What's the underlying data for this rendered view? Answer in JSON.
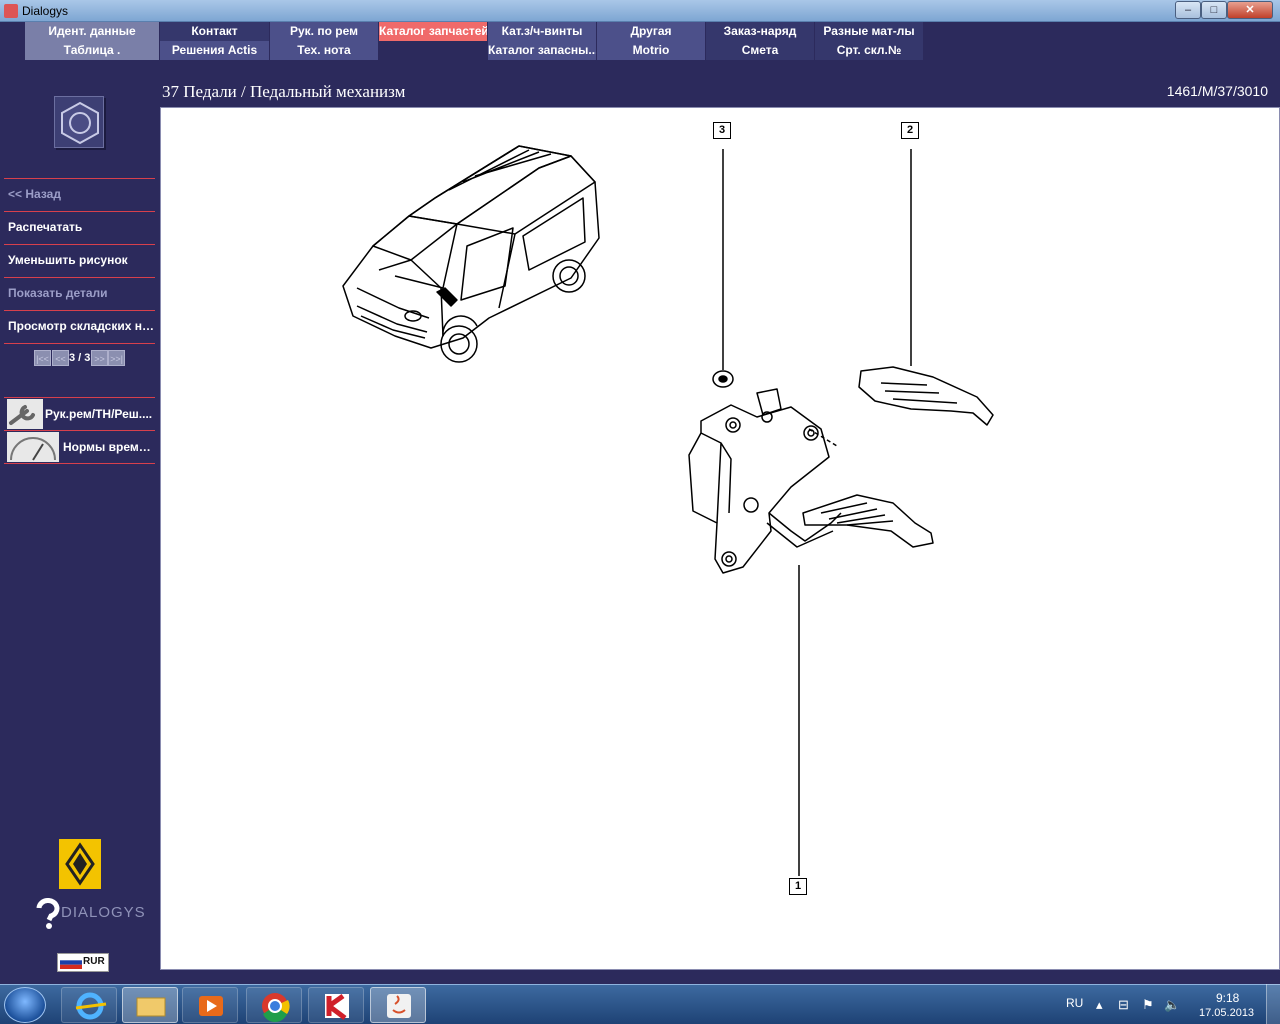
{
  "window": {
    "title": "Dialogys",
    "controls": {
      "minimize": "–",
      "maximize": "□",
      "close": "✕"
    }
  },
  "tabs_row1": [
    {
      "label": "Идент. данные",
      "style": "light"
    },
    {
      "label": "Контакт",
      "style": "dark"
    },
    {
      "label": "Рук. по рем",
      "style": "mid"
    },
    {
      "label": "Каталог запчастей",
      "style": "active"
    },
    {
      "label": "Кат.з/ч-винты",
      "style": "mid"
    },
    {
      "label": "Другая",
      "style": "mid"
    },
    {
      "label": "Заказ-наряд",
      "style": "dark"
    },
    {
      "label": "Разные мат-лы",
      "style": "dark"
    }
  ],
  "tabs_row2": [
    {
      "label": "Таблица .",
      "style": "light"
    },
    {
      "label": "Решения Actis",
      "style": "mid"
    },
    {
      "label": "Тех. нота",
      "style": "mid"
    },
    {
      "label": "Каталог запасны...",
      "style": "mid"
    },
    {
      "label": "Motrio",
      "style": "mid"
    },
    {
      "label": "Смета",
      "style": "dark"
    },
    {
      "label": "Срт. скл.№",
      "style": "dark"
    }
  ],
  "header": {
    "title": "37 Педали / Педальный механизм",
    "code": "1461/M/37/3010"
  },
  "sidebar": {
    "back": "<< Назад",
    "print": "Распечатать",
    "shrink": "Уменьшить рисунок",
    "show_details": "Показать детали",
    "stock_view": "Просмотр складских но...",
    "pager": {
      "text": "3 / 3",
      "first": "|<<",
      "prev": "<<",
      "next": ">>",
      "last": ">>|"
    },
    "tools": [
      {
        "label": "Рук.рем/ТН/Реш....",
        "icon": "wrench-icon"
      },
      {
        "label": "Нормы време...",
        "icon": "gauge-icon"
      }
    ],
    "brand_text": "DIALOGYS",
    "currency": "RUR"
  },
  "diagram": {
    "callouts": [
      "3",
      "2",
      "1"
    ]
  },
  "taskbar": {
    "language": "RU",
    "time": "9:18",
    "date": "17.05.2013",
    "apps": [
      "explorer-icon",
      "ie-icon",
      "folder-icon",
      "media-icon",
      "chrome-icon",
      "kaspersky-icon",
      "java-icon"
    ]
  }
}
